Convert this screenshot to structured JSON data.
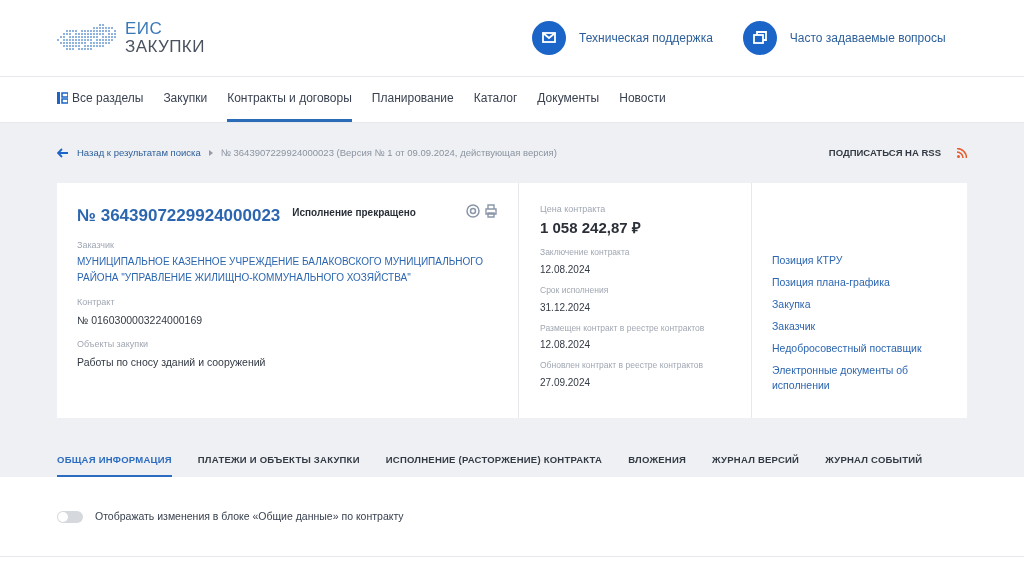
{
  "logo": {
    "line1": "ЕИС",
    "line2": "ЗАКУПКИ"
  },
  "header_links": [
    {
      "kind": "mail",
      "label": "Техническая поддержка"
    },
    {
      "kind": "windows",
      "label": "Часто задаваемые вопросы"
    }
  ],
  "nav": [
    {
      "label": "Все разделы",
      "kind": "sections",
      "selected": false
    },
    {
      "label": "Закупки",
      "kind": "plain",
      "selected": false
    },
    {
      "label": "Контракты и договоры",
      "kind": "plain",
      "selected": true
    },
    {
      "label": "Планирование",
      "kind": "plain",
      "selected": false
    },
    {
      "label": "Каталог",
      "kind": "plain",
      "selected": false
    },
    {
      "label": "Документы",
      "kind": "plain",
      "selected": false
    },
    {
      "label": "Новости",
      "kind": "plain",
      "selected": false
    }
  ],
  "breadcrumb": {
    "back": "Назад к результатам поиска",
    "current": "№ 3643907229924000023 (Версия № 1 от 09.09.2024, действующая версия)"
  },
  "rss": "ПОДПИСАТЬСЯ НА RSS",
  "card": {
    "number": "№ 3643907229924000023",
    "status": "Исполнение прекращено",
    "fields": [
      {
        "label": "Заказчик",
        "value": "МУНИЦИПАЛЬНОЕ КАЗЕННОЕ УЧРЕЖДЕНИЕ БАЛАКОВСКОГО МУНИЦИПАЛЬНОГО РАЙОНА \"УПРАВЛЕНИЕ ЖИЛИЩНО-КОММУНАЛЬНОГО ХОЗЯЙСТВА\"",
        "kind": "link"
      },
      {
        "label": "Контракт",
        "value": "№ 0160300003224000169",
        "kind": "text"
      },
      {
        "label": "Объекты закупки",
        "value": "Работы по сносу зданий и сооружений",
        "kind": "text"
      }
    ],
    "price": {
      "label": "Цена контракта",
      "value": "1 058 242,87 ₽"
    },
    "dates": [
      {
        "label": "Заключение контракта",
        "value": "12.08.2024"
      },
      {
        "label": "Срок исполнения",
        "value": "31.12.2024"
      },
      {
        "label": "Размещен контракт в реестре контрактов",
        "value": "12.08.2024"
      },
      {
        "label": "Обновлен контракт в реестре контрактов",
        "value": "27.09.2024"
      }
    ],
    "links": [
      "Позиция КТРУ",
      "Позиция плана-графика",
      "Закупка",
      "Заказчик",
      "Недобросовестный поставщик",
      "Электронные документы об исполнении"
    ]
  },
  "tabs": [
    {
      "label": "ОБЩАЯ ИНФОРМАЦИЯ",
      "selected": true
    },
    {
      "label": "ПЛАТЕЖИ И ОБЪЕКТЫ ЗАКУПКИ",
      "selected": false
    },
    {
      "label": "ИСПОЛНЕНИЕ (РАСТОРЖЕНИЕ) КОНТРАКТА",
      "selected": false
    },
    {
      "label": "ВЛОЖЕНИЯ",
      "selected": false
    },
    {
      "label": "ЖУРНАЛ ВЕРСИЙ",
      "selected": false
    },
    {
      "label": "ЖУРНАЛ СОБЫТИЙ",
      "selected": false
    }
  ],
  "toggle": {
    "label": "Отображать изменения в блоке «Общие данные» по контракту",
    "on": false
  }
}
